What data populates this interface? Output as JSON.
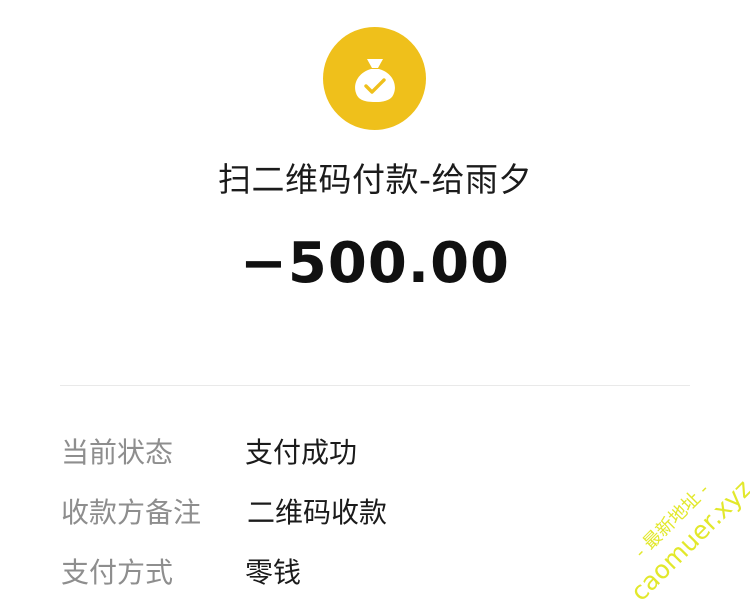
{
  "transaction": {
    "icon": "money-bag-check-icon",
    "title": "扫二维码付款-给雨夕",
    "amount": "−500.00"
  },
  "details": [
    {
      "label": "当前状态",
      "value": "支付成功"
    },
    {
      "label": "收款方备注",
      "value": "二维码收款"
    },
    {
      "label": "支付方式",
      "value": "零钱"
    }
  ],
  "watermark": {
    "line1": "- 最新地址 -",
    "line2": "caomuer.xyz"
  },
  "colors": {
    "icon_bg": "#efc01b",
    "label_text": "#8e8e8e",
    "value_text": "#1b1b1b",
    "watermark": "#e2e82b"
  }
}
